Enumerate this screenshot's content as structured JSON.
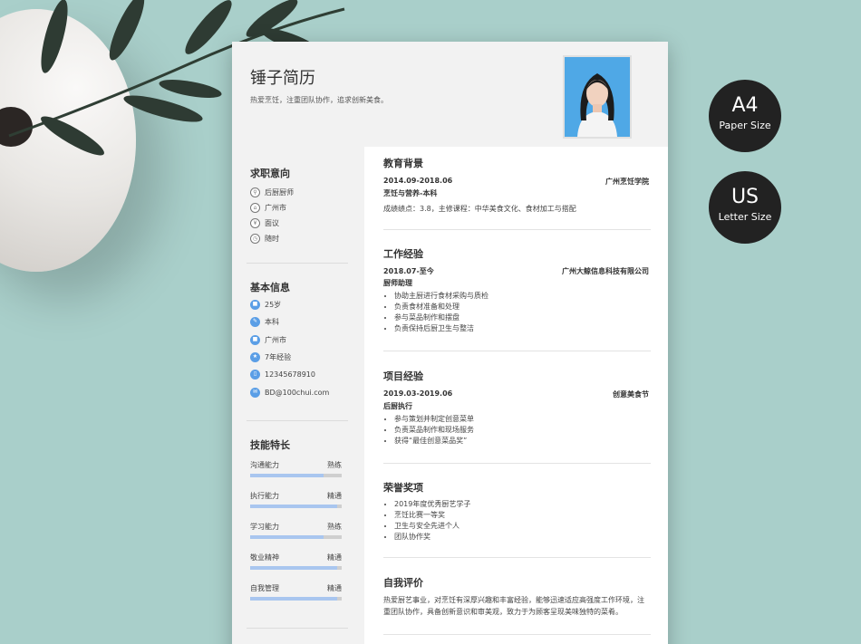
{
  "resume": {
    "name": "锤子简历",
    "slogan": "热爱烹饪，注重团队协作，追求创新美食。",
    "sidebar": {
      "intent": {
        "title": "求职意向",
        "items": [
          {
            "icon": "chef-icon",
            "glyph": "⚲",
            "label": "后厨厨师"
          },
          {
            "icon": "city-icon",
            "glyph": "⌂",
            "label": "广州市"
          },
          {
            "icon": "salary-icon",
            "glyph": "¥",
            "label": "面议"
          },
          {
            "icon": "clock-icon",
            "glyph": "◷",
            "label": "随时"
          }
        ]
      },
      "basic": {
        "title": "基本信息",
        "items": [
          {
            "icon": "age-icon",
            "glyph": "■",
            "label": "25岁"
          },
          {
            "icon": "education-icon",
            "glyph": "✎",
            "label": "本科"
          },
          {
            "icon": "location-icon",
            "glyph": "■",
            "label": "广州市"
          },
          {
            "icon": "experience-icon",
            "glyph": "★",
            "label": "7年经验"
          },
          {
            "icon": "phone-icon",
            "glyph": "▯",
            "label": "12345678910"
          },
          {
            "icon": "email-icon",
            "glyph": "✉",
            "label": "BD@100chui.com"
          }
        ]
      },
      "skills": {
        "title": "技能特长",
        "items": [
          {
            "name": "沟通能力",
            "level": "熟练",
            "value": 0.8
          },
          {
            "name": "执行能力",
            "level": "精通",
            "value": 0.95
          },
          {
            "name": "学习能力",
            "level": "熟练",
            "value": 0.8
          },
          {
            "name": "敬业精神",
            "level": "精通",
            "value": 0.95
          },
          {
            "name": "自我管理",
            "level": "精通",
            "value": 0.95
          }
        ]
      }
    },
    "education": {
      "title": "教育背景",
      "period": "2014.09-2018.06",
      "org": "广州烹饪学院",
      "role": "烹饪与营养-本科",
      "detail": "成绩绩点：3.8，主修课程：中华美食文化、食材加工与搭配"
    },
    "work": {
      "title": "工作经验",
      "period": "2018.07-至今",
      "org": "广州大鲸信息科技有限公司",
      "role": "厨师助理",
      "bullets": [
        "协助主厨进行食材采购与质检",
        "负责食材准备和处理",
        "参与菜品制作和摆盘",
        "负责保持后厨卫生与整洁"
      ]
    },
    "project": {
      "title": "项目经验",
      "period": "2019.03-2019.06",
      "org": "创意美食节",
      "role": "后厨执行",
      "bullets": [
        "参与策划并制定创意菜单",
        "负责菜品制作和现场服务",
        "获得“最佳创意菜品奖”"
      ]
    },
    "honors": {
      "title": "荣誉奖项",
      "bullets": [
        "2019年度优秀厨艺学子",
        "烹饪比赛一等奖",
        "卫生与安全先进个人",
        "团队协作奖"
      ]
    },
    "evaluation": {
      "title": "自我评价",
      "text": "热爱厨艺事业，对烹饪有深厚兴趣和丰富经验，能够迅速适应高强度工作环境，注重团队协作，具备创新意识和审美观，致力于为顾客呈现美味独特的菜肴。"
    }
  },
  "badges": {
    "a4": {
      "big": "A4",
      "small": "Paper Size"
    },
    "us": {
      "big": "US",
      "small": "Letter Size"
    }
  },
  "colors": {
    "background": "#a9cfca",
    "icon_blue": "#5a9ee6",
    "skill_fill": "#a9c6ef",
    "badge": "#222222"
  }
}
